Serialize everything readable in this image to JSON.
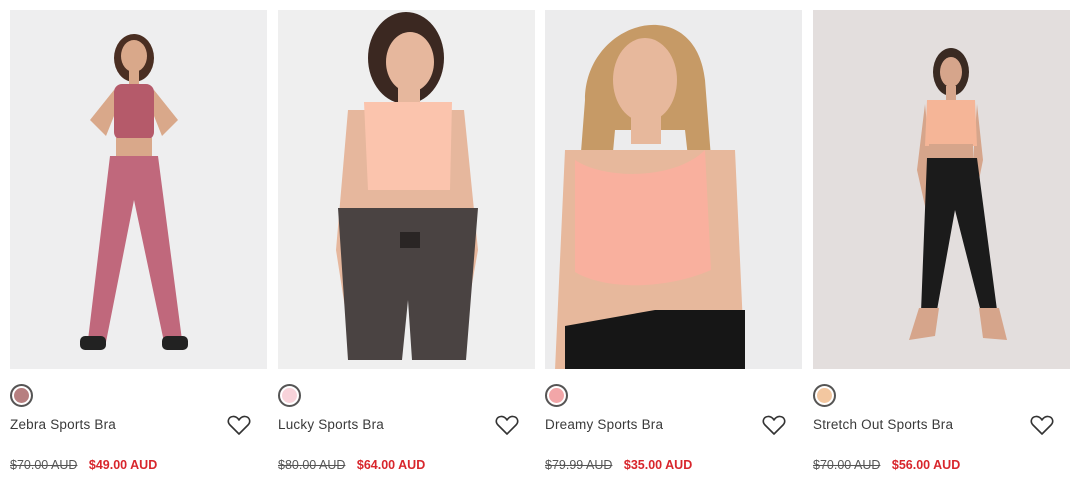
{
  "products": [
    {
      "name": "Zebra Sports Bra",
      "old_price": "$70.00 AUD",
      "sale_price": "$49.00 AUD",
      "swatch_color": "#b77f80",
      "bg": "#eeeeef",
      "top": "#b55a6a",
      "bottom": "#c0687c",
      "skin": "#d9a88a",
      "hair": "#4a2e22"
    },
    {
      "name": "Lucky Sports Bra",
      "old_price": "$80.00 AUD",
      "sale_price": "$64.00 AUD",
      "swatch_color": "#f8d3da",
      "bg": "#efefef",
      "top": "#fbc4ad",
      "bottom": "#4a4342",
      "skin": "#e6b79d",
      "hair": "#3b2821"
    },
    {
      "name": "Dreamy Sports Bra",
      "old_price": "$79.99 AUD",
      "sale_price": "$35.00 AUD",
      "swatch_color": "#f2a6a8",
      "bg": "#ececed",
      "top": "#f9b09e",
      "bottom": "#161616",
      "skin": "#e7b89c",
      "hair": "#c69a66"
    },
    {
      "name": "Stretch Out Sports Bra",
      "old_price": "$70.00 AUD",
      "sale_price": "$56.00 AUD",
      "swatch_color": "#f3c7a0",
      "bg": "#e3dedd",
      "top": "#f5b597",
      "bottom": "#1b1b1b",
      "skin": "#d6a58b",
      "hair": "#3a2a22"
    }
  ]
}
